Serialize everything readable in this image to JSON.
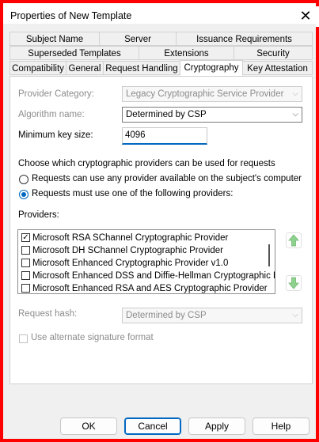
{
  "window": {
    "title": "Properties of New Template",
    "close_glyph": "✕"
  },
  "tabs": {
    "row1": [
      "Subject Name",
      "Server",
      "Issuance Requirements"
    ],
    "row2": [
      "Superseded Templates",
      "Extensions",
      "Security"
    ],
    "row3": [
      "Compatibility",
      "General",
      "Request Handling",
      "Cryptography",
      "Key Attestation"
    ],
    "active": "Cryptography"
  },
  "provider_category": {
    "label": "Provider Category:",
    "value": "Legacy Cryptographic Service Provider",
    "enabled": false
  },
  "algorithm_name": {
    "label": "Algorithm name:",
    "value": "Determined by CSP",
    "enabled": true
  },
  "min_key_size": {
    "label": "Minimum key size:",
    "value": "4096"
  },
  "choose_prompt": "Choose which cryptographic providers can be used for requests",
  "radios": [
    {
      "label": "Requests can use any provider available on the subject's computer",
      "selected": false
    },
    {
      "label": "Requests must use one of the following providers:",
      "selected": true
    }
  ],
  "providers": {
    "label": "Providers:",
    "items": [
      {
        "label": "Microsoft RSA SChannel Cryptographic Provider",
        "checked": true
      },
      {
        "label": "Microsoft DH SChannel Cryptographic Provider",
        "checked": false
      },
      {
        "label": "Microsoft Enhanced Cryptographic Provider v1.0",
        "checked": false
      },
      {
        "label": "Microsoft Enhanced DSS and Diffie-Hellman Cryptographic Pr",
        "checked": false
      },
      {
        "label": "Microsoft Enhanced RSA and AES Cryptographic Provider",
        "checked": false
      }
    ],
    "move_up_icon": "arrow-up-icon",
    "move_down_icon": "arrow-down-icon"
  },
  "request_hash": {
    "label": "Request hash:",
    "value": "Determined by CSP",
    "enabled": false
  },
  "alt_signature": {
    "label": "Use alternate signature format",
    "checked": false,
    "enabled": false
  },
  "buttons": {
    "ok": "OK",
    "cancel": "Cancel",
    "apply": "Apply",
    "help": "Help"
  },
  "colors": {
    "frame": "#ff0000",
    "accent": "#0067c0",
    "arrow_green": "#8fd18f"
  }
}
